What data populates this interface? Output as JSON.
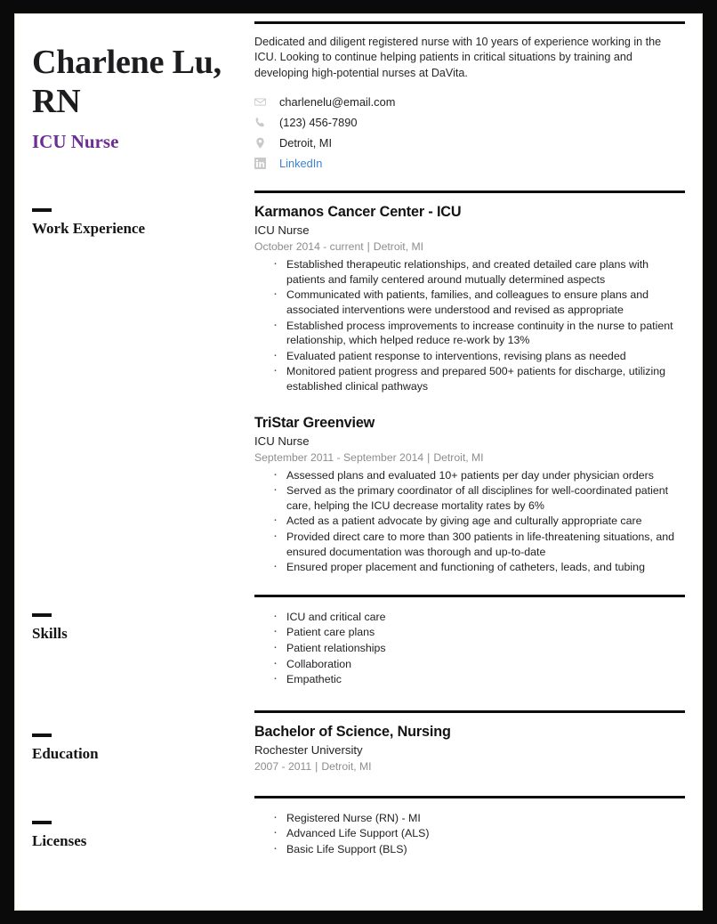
{
  "document": {
    "type": "resume"
  },
  "colors": {
    "accent_purple": "#6d2e94",
    "link_blue": "#3d80d6",
    "rule_black": "#0d0d0d",
    "muted_gray": "#8d8d8d",
    "icon_gray": "#c9c9c9"
  },
  "header": {
    "name": "Charlene Lu, RN",
    "headline": "ICU Nurse",
    "summary": "Dedicated and diligent registered nurse with 10 years of experience working in the ICU. Looking to continue helping patients in critical situations by training and developing high-potential nurses at DaVita.",
    "contacts": [
      {
        "icon": "envelope-icon",
        "text": "charlenelu@email.com",
        "is_link": false
      },
      {
        "icon": "phone-icon",
        "text": "(123) 456-7890",
        "is_link": false
      },
      {
        "icon": "location-pin-icon",
        "text": "Detroit, MI",
        "is_link": false
      },
      {
        "icon": "linkedin-icon",
        "text": "LinkedIn",
        "is_link": true
      }
    ]
  },
  "sections": {
    "work_experience": {
      "label": "Work Experience",
      "entries": [
        {
          "organization": "Karmanos Cancer Center - ICU",
          "role": "ICU Nurse",
          "dates": "October 2014 - current",
          "location": "Detroit, MI",
          "bullets": [
            "Established therapeutic relationships, and created detailed care plans with patients and family centered around mutually determined aspects",
            "Communicated with patients, families, and colleagues to ensure plans and associated interventions were understood and revised as appropriate",
            "Established process improvements to increase continuity in the nurse to patient relationship, which helped reduce re-work by 13%",
            "Evaluated patient response to interventions, revising plans as needed",
            "Monitored patient progress and prepared 500+ patients for discharge, utilizing established clinical pathways"
          ]
        },
        {
          "organization": "TriStar Greenview",
          "role": "ICU Nurse",
          "dates": "September 2011 - September 2014",
          "location": "Detroit, MI",
          "bullets": [
            "Assessed plans and evaluated 10+ patients per day under physician orders",
            "Served as the primary coordinator of all disciplines for well-coordinated patient care, helping the ICU decrease mortality rates by 6%",
            "Acted as a patient advocate by giving age and culturally appropriate care",
            "Provided direct care to more than 300 patients in life-threatening situations, and ensured documentation was thorough and up-to-date",
            "Ensured proper placement and functioning of catheters, leads, and tubing"
          ]
        }
      ]
    },
    "skills": {
      "label": "Skills",
      "items": [
        "ICU and critical care",
        "Patient care plans",
        "Patient relationships",
        "Collaboration",
        "Empathetic"
      ]
    },
    "education": {
      "label": "Education",
      "entries": [
        {
          "degree": "Bachelor of Science, Nursing",
          "school": "Rochester University",
          "dates": "2007 - 2011",
          "location": "Detroit, MI"
        }
      ]
    },
    "licenses": {
      "label": "Licenses",
      "items": [
        "Registered Nurse (RN) - MI",
        "Advanced Life Support (ALS)",
        "Basic Life Support (BLS)"
      ]
    }
  }
}
